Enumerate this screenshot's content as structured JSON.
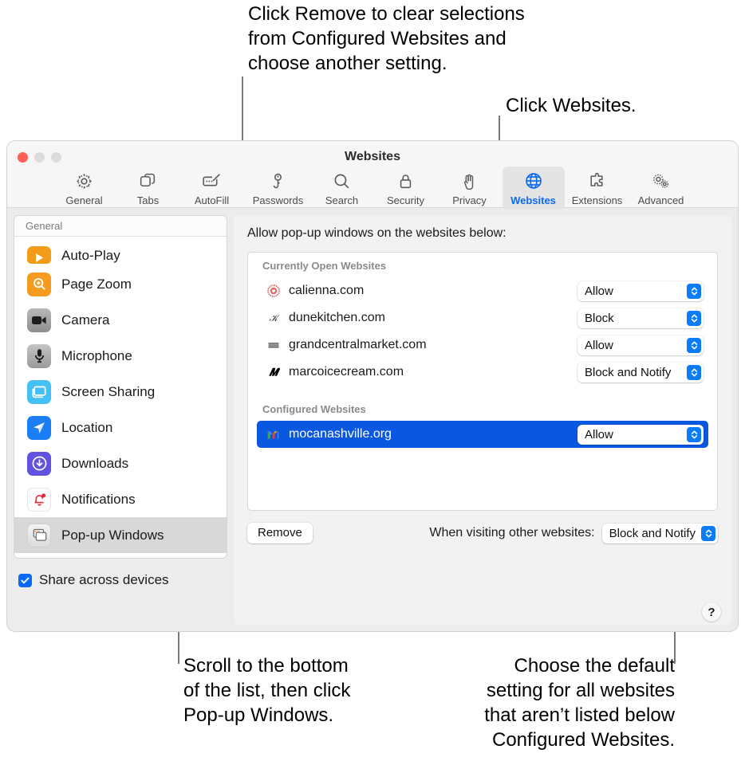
{
  "annotations": {
    "top_left": "Click Remove to clear selections\nfrom Configured Websites and\nchoose another setting.",
    "top_right": "Click Websites.",
    "bottom_left": "Scroll to the bottom\nof the list, then click\nPop-up Windows.",
    "bottom_right": "Choose the default\nsetting for all websites\nthat aren’t listed below\nConfigured Websites."
  },
  "window": {
    "title": "Websites",
    "traffic_lights": [
      "close",
      "minimize",
      "maximize"
    ]
  },
  "toolbar": {
    "items": [
      {
        "label": "General",
        "icon": "gear-icon",
        "active": false
      },
      {
        "label": "Tabs",
        "icon": "tabs-icon",
        "active": false
      },
      {
        "label": "AutoFill",
        "icon": "autofill-icon",
        "active": false
      },
      {
        "label": "Passwords",
        "icon": "key-icon",
        "active": false
      },
      {
        "label": "Search",
        "icon": "search-icon",
        "active": false
      },
      {
        "label": "Security",
        "icon": "lock-icon",
        "active": false
      },
      {
        "label": "Privacy",
        "icon": "hand-icon",
        "active": false
      },
      {
        "label": "Websites",
        "icon": "globe-icon",
        "active": true
      },
      {
        "label": "Extensions",
        "icon": "puzzle-icon",
        "active": false
      },
      {
        "label": "Advanced",
        "icon": "gears-icon",
        "active": false
      }
    ]
  },
  "sidebar": {
    "header": "General",
    "items": [
      {
        "label": "Auto-Play",
        "icon": "auto-play-icon",
        "selected": false
      },
      {
        "label": "Page Zoom",
        "icon": "page-zoom-icon",
        "selected": false
      },
      {
        "label": "Camera",
        "icon": "camera-icon",
        "selected": false
      },
      {
        "label": "Microphone",
        "icon": "microphone-icon",
        "selected": false
      },
      {
        "label": "Screen Sharing",
        "icon": "screen-sharing-icon",
        "selected": false
      },
      {
        "label": "Location",
        "icon": "location-icon",
        "selected": false
      },
      {
        "label": "Downloads",
        "icon": "downloads-icon",
        "selected": false
      },
      {
        "label": "Notifications",
        "icon": "notifications-icon",
        "selected": false
      },
      {
        "label": "Pop-up Windows",
        "icon": "popup-windows-icon",
        "selected": true
      }
    ],
    "share_checkbox": {
      "label": "Share across devices",
      "checked": true
    }
  },
  "main": {
    "title": "Allow pop-up windows on the websites below:",
    "groups": [
      {
        "header": "Currently Open Websites",
        "rows": [
          {
            "site": "calienna.com",
            "favicon": "calienna-favicon",
            "setting": "Allow",
            "selected": false
          },
          {
            "site": "dunekitchen.com",
            "favicon": "dunekitchen-favicon",
            "setting": "Block",
            "selected": false
          },
          {
            "site": "grandcentralmarket.com",
            "favicon": "grandcentral-favicon",
            "setting": "Allow",
            "selected": false
          },
          {
            "site": "marcoicecream.com",
            "favicon": "marcoicecream-favicon",
            "setting": "Block and Notify",
            "selected": false
          }
        ]
      },
      {
        "header": "Configured Websites",
        "rows": [
          {
            "site": "mocanashville.org",
            "favicon": "mocanashville-favicon",
            "setting": "Allow",
            "selected": true
          }
        ]
      }
    ],
    "footer": {
      "remove_label": "Remove",
      "default_label": "When visiting other websites:",
      "default_setting": "Block and Notify"
    },
    "help_label": "?"
  },
  "colors": {
    "accent": "#0a69f5",
    "selection": "#0a57e0",
    "popup_arrow": "#0a7cf7"
  }
}
